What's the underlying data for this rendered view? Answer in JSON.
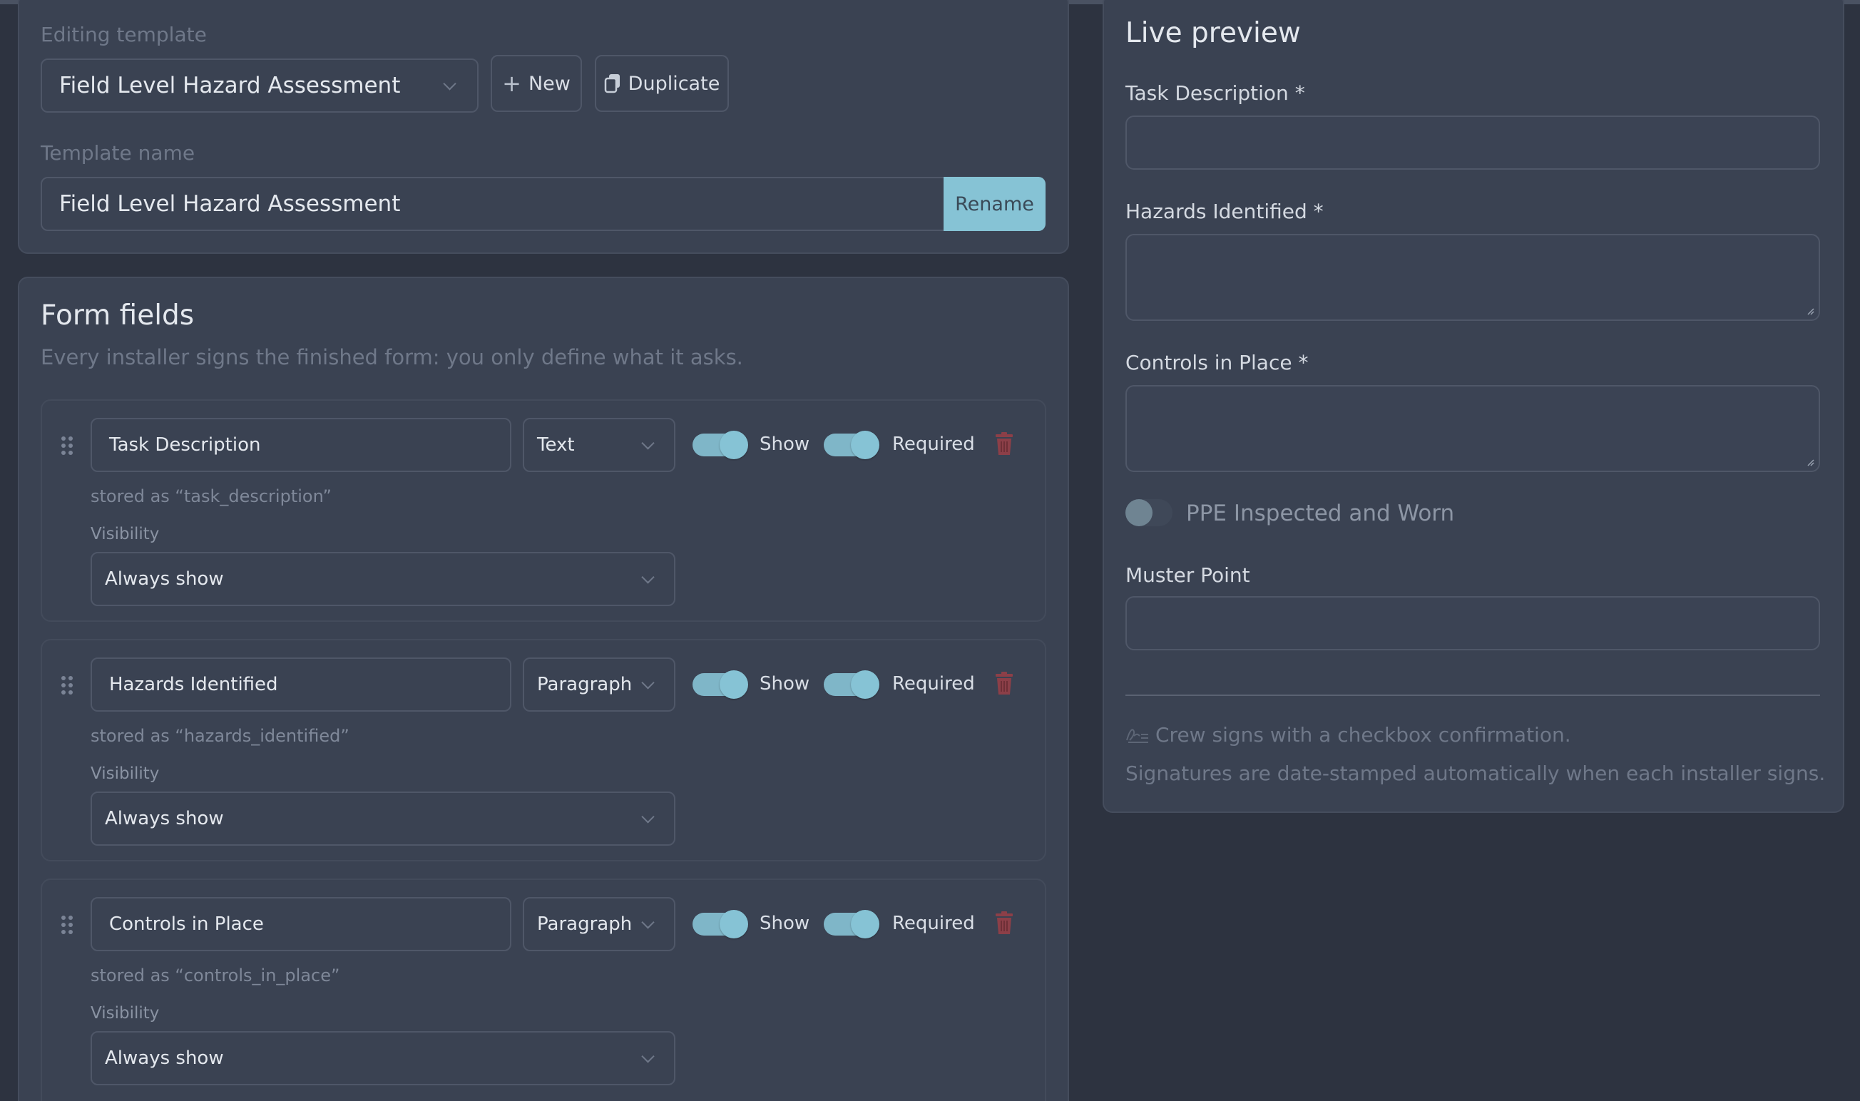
{
  "template_editor": {
    "editing_label": "Editing template",
    "selected_template": "Field Level Hazard Assessment",
    "new_label": "New",
    "duplicate_label": "Duplicate",
    "name_label": "Template name",
    "name_value": "Field Level Hazard Assessment",
    "rename_label": "Rename"
  },
  "form_fields": {
    "title": "Form fields",
    "subtitle": "Every installer signs the finished form: you only define what it asks.",
    "show_label": "Show",
    "required_label": "Required",
    "visibility_label": "Visibility",
    "items": [
      {
        "label": "Task Description",
        "type": "Text",
        "stored": "stored as “task_description”",
        "visibility": "Always show",
        "show": true,
        "required": true
      },
      {
        "label": "Hazards Identified",
        "type": "Paragraph",
        "stored": "stored as “hazards_identified”",
        "visibility": "Always show",
        "show": true,
        "required": true
      },
      {
        "label": "Controls in Place",
        "type": "Paragraph",
        "stored": "stored as “controls_in_place”",
        "visibility": "Always show",
        "show": true,
        "required": true
      }
    ]
  },
  "live_preview": {
    "title": "Live preview",
    "fields": [
      {
        "label": "Task Description *"
      },
      {
        "label": "Hazards Identified *"
      },
      {
        "label": "Controls in Place *"
      },
      {
        "label": "PPE Inspected and Worn"
      },
      {
        "label": "Muster Point"
      }
    ],
    "sign_note": "Crew signs with a checkbox confirmation.",
    "date_note": "Signatures are date-stamped automatically when each installer signs."
  },
  "colors": {
    "background": "#2d3340",
    "card": "#3a4252",
    "accent": "#86c3d5",
    "danger": "#8c3f48"
  }
}
